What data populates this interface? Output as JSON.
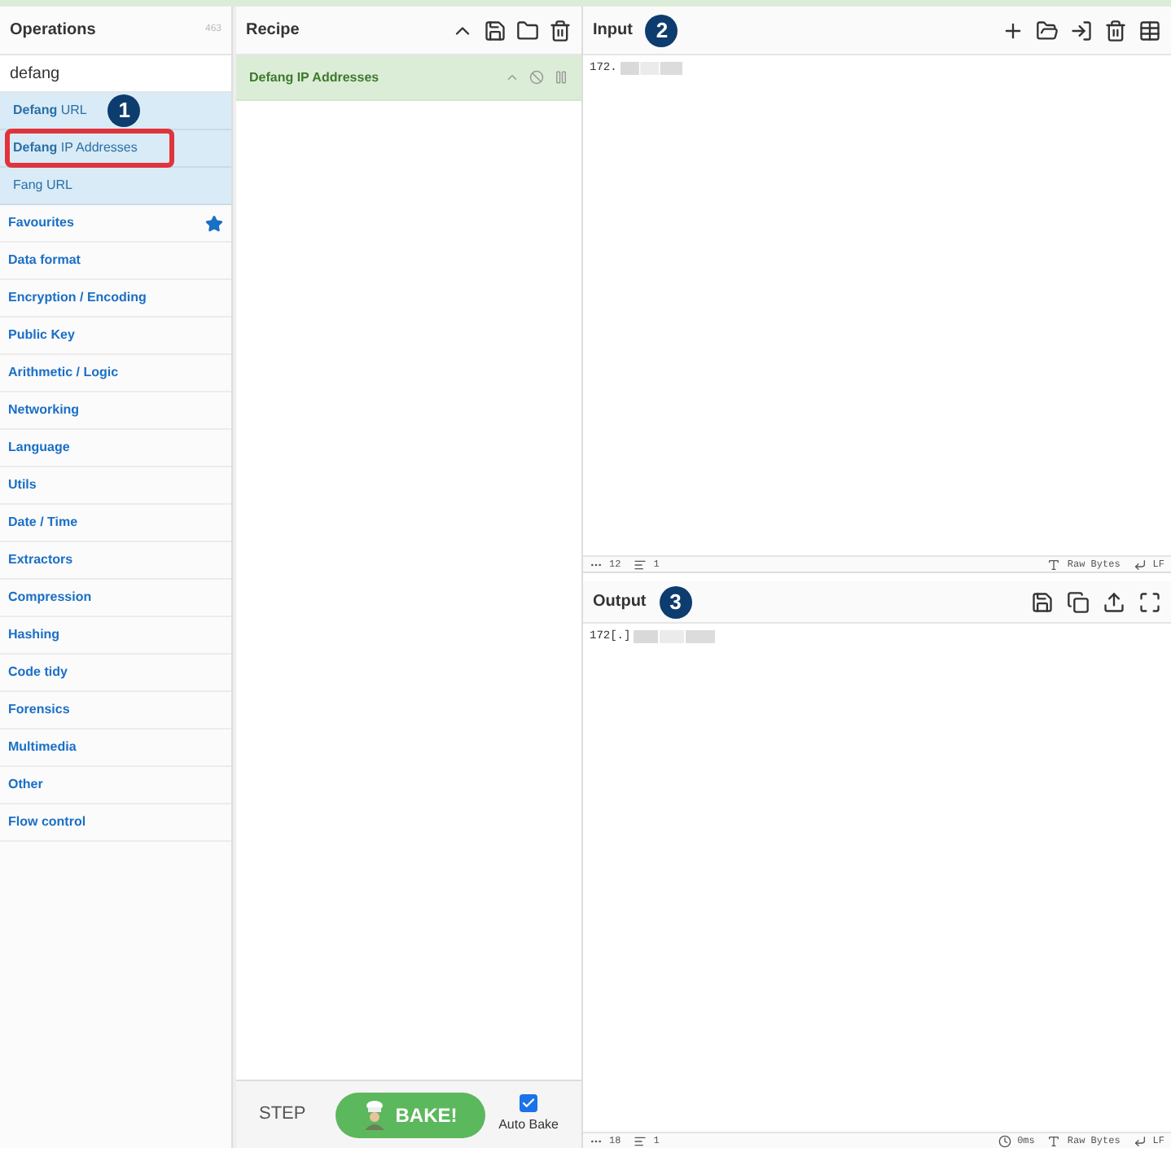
{
  "operations": {
    "title": "Operations",
    "count": "463",
    "search": {
      "value": "defang"
    },
    "results": [
      {
        "label": "**Defang** URL",
        "badge": "1",
        "outlined": false
      },
      {
        "label": "**Defang** IP Addresses",
        "outlined": true
      },
      {
        "label": "Fang URL",
        "outlined": false
      }
    ],
    "categories": [
      {
        "label": "Favourites",
        "starred": true
      },
      {
        "label": "Data format",
        "starred": false
      },
      {
        "label": "Encryption / Encoding",
        "starred": false
      },
      {
        "label": "Public Key",
        "starred": false
      },
      {
        "label": "Arithmetic / Logic",
        "starred": false
      },
      {
        "label": "Networking",
        "starred": false
      },
      {
        "label": "Language",
        "starred": false
      },
      {
        "label": "Utils",
        "starred": false
      },
      {
        "label": "Date / Time",
        "starred": false
      },
      {
        "label": "Extractors",
        "starred": false
      },
      {
        "label": "Compression",
        "starred": false
      },
      {
        "label": "Hashing",
        "starred": false
      },
      {
        "label": "Code tidy",
        "starred": false
      },
      {
        "label": "Forensics",
        "starred": false
      },
      {
        "label": "Multimedia",
        "starred": false
      },
      {
        "label": "Other",
        "starred": false
      },
      {
        "label": "Flow control",
        "starred": false
      }
    ]
  },
  "recipe": {
    "title": "Recipe",
    "steps": [
      {
        "label": "Defang IP Addresses",
        "disabled": false
      }
    ],
    "step_button": "STEP",
    "bake_button": "BAKE!",
    "auto_bake": {
      "label": "Auto Bake",
      "checked": true
    }
  },
  "input": {
    "title": "Input",
    "badge": "2",
    "value": "172.",
    "status": {
      "length": "12",
      "lines": "1",
      "encoding": "Raw Bytes",
      "eol": "LF"
    }
  },
  "output": {
    "title": "Output",
    "badge": "3",
    "value": "172[.]",
    "status": {
      "length": "18",
      "lines": "1",
      "time": "0ms",
      "encoding": "Raw Bytes",
      "eol": "LF"
    }
  }
}
